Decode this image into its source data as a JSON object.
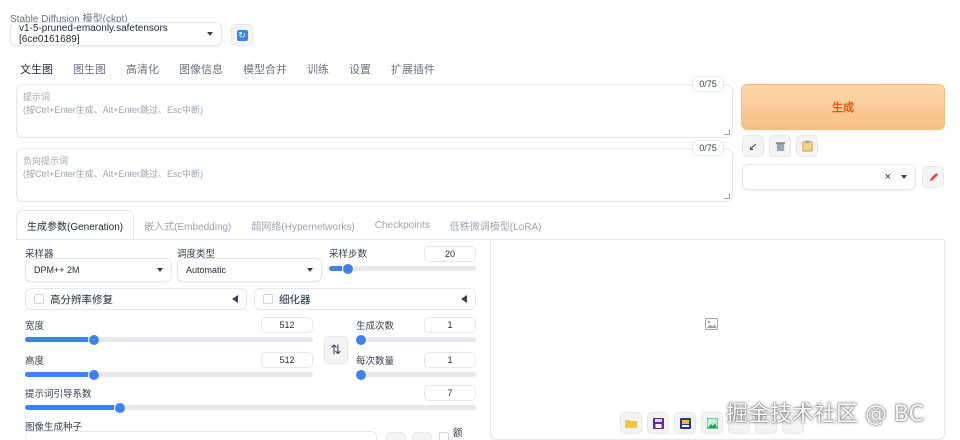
{
  "model": {
    "label": "Stable Diffusion 模型(ckpt)",
    "selected": "v1-5-pruned-emaonly.safetensors [6ce0161689]"
  },
  "main_tabs": [
    {
      "label": "文生图",
      "active": true
    },
    {
      "label": "图生图"
    },
    {
      "label": "高清化"
    },
    {
      "label": "图像信息"
    },
    {
      "label": "模型合并"
    },
    {
      "label": "训练"
    },
    {
      "label": "设置"
    },
    {
      "label": "扩展插件"
    }
  ],
  "prompt": {
    "label": "提示词",
    "hint": "(按Ctrl+Enter生成、Alt+Enter跳过、Esc中断)",
    "counter": "0/75"
  },
  "negative_prompt": {
    "label": "负向提示词",
    "hint": "(按Ctrl+Enter生成、Alt+Enter跳过、Esc中断)",
    "counter": "0/75"
  },
  "generate_label": "生成",
  "sub_tabs": [
    {
      "label": "生成参数(Generation)",
      "active": true
    },
    {
      "label": "嵌入式(Embedding)"
    },
    {
      "label": "超网络(Hypernetworks)"
    },
    {
      "label": "Checkpoints"
    },
    {
      "label": "低秩微调模型(LoRA)"
    }
  ],
  "params": {
    "sampler": {
      "label": "采样器",
      "value": "DPM++ 2M"
    },
    "schedule": {
      "label": "调度类型",
      "value": "Automatic"
    },
    "steps": {
      "label": "采样步数",
      "value": "20",
      "fraction": 0.13
    },
    "hires_label": "高分辨率修复",
    "refiner_label": "细化器",
    "width": {
      "label": "宽度",
      "value": "512",
      "fraction": 0.24
    },
    "height": {
      "label": "高度",
      "value": "512",
      "fraction": 0.24
    },
    "batch_count": {
      "label": "生成次数",
      "value": "1",
      "fraction": 0.0
    },
    "batch_size": {
      "label": "每次数量",
      "value": "1",
      "fraction": 0.0
    },
    "cfg": {
      "label": "提示词引导系数",
      "value": "7",
      "fraction": 0.21
    },
    "seed_label": "图像生成种子",
    "extra_label": "额"
  },
  "icons": {
    "refresh": "refresh-icon",
    "swap": "swap-icon",
    "arrow": "arrow-icon",
    "trash": "trash-icon",
    "clipboard": "clipboard-icon",
    "clear": "clear-icon",
    "pen": "pen-icon",
    "image": "image-icon",
    "folder": "folder-icon",
    "save": "save-icon",
    "zip": "zip-icon",
    "picture": "picture-icon"
  },
  "symbols": {
    "clear": "×",
    "arrow": "↙",
    "swap": "⇅"
  },
  "watermark": "掘金技术社区 @ BC"
}
